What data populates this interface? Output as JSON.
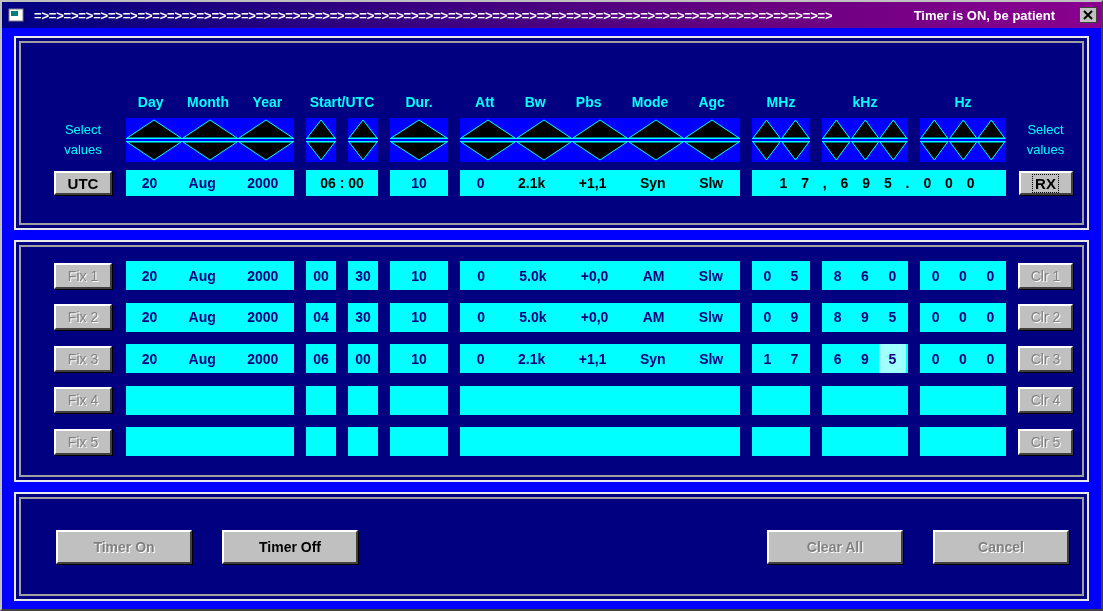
{
  "title_bar": {
    "marquee": "=>=>=>=>=>=>=>=>=>=>=>=>=>=>=>=>=>=>=>=>=>=>=>=>=>=>=>=>=>=>=>=>=>=>=>=>=>=>=>=>=>=>=>=>=>=>=>=>=>=>=>=>=>=>",
    "status": "Timer is ON, be patient"
  },
  "headers": {
    "date": [
      "Day",
      "Month",
      "Year"
    ],
    "start": "Start/UTC",
    "duration": "Dur.",
    "settings": [
      "Att",
      "Bw",
      "Pbs",
      "Mode",
      "Agc"
    ],
    "mhz": "MHz",
    "khz": "kHz",
    "hz": "Hz"
  },
  "select_left": "Select values",
  "select_right": "Select values",
  "current": {
    "utc_button": "UTC",
    "date": [
      "20",
      "Aug",
      "2000"
    ],
    "time": "06 : 00",
    "duration": "10",
    "settings": [
      "0",
      "2.1k",
      "+1,1",
      "Syn",
      "Slw"
    ],
    "frequency": "1 7 , 6 9 5 . 0 0 0",
    "rx_button": "RX"
  },
  "presets": [
    {
      "fix": "Fix 1",
      "clear": "Clr 1",
      "disabled": true,
      "date": [
        "20",
        "Aug",
        "2000"
      ],
      "hour": "00",
      "minute": "30",
      "duration": "10",
      "settings": [
        "0",
        "5.0k",
        "+0,0",
        "AM",
        "Slw"
      ],
      "mhz": [
        {
          "text": "0",
          "selected": false
        },
        {
          "text": "5",
          "selected": false
        }
      ],
      "khz": [
        {
          "text": "8",
          "selected": false
        },
        {
          "text": "6",
          "selected": false
        },
        {
          "text": "0",
          "selected": false
        }
      ],
      "hz": [
        {
          "text": "0",
          "selected": false
        },
        {
          "text": "0",
          "selected": false
        },
        {
          "text": "0",
          "selected": false
        }
      ]
    },
    {
      "fix": "Fix 2",
      "clear": "Clr 2",
      "disabled": true,
      "date": [
        "20",
        "Aug",
        "2000"
      ],
      "hour": "04",
      "minute": "30",
      "duration": "10",
      "settings": [
        "0",
        "5.0k",
        "+0,0",
        "AM",
        "Slw"
      ],
      "mhz": [
        {
          "text": "0",
          "selected": false
        },
        {
          "text": "9",
          "selected": false
        }
      ],
      "khz": [
        {
          "text": "8",
          "selected": false
        },
        {
          "text": "9",
          "selected": false
        },
        {
          "text": "5",
          "selected": false
        }
      ],
      "hz": [
        {
          "text": "0",
          "selected": false
        },
        {
          "text": "0",
          "selected": false
        },
        {
          "text": "0",
          "selected": false
        }
      ]
    },
    {
      "fix": "Fix 3",
      "clear": "Clr 3",
      "disabled": true,
      "date": [
        "20",
        "Aug",
        "2000"
      ],
      "hour": "06",
      "minute": "00",
      "duration": "10",
      "settings": [
        "0",
        "2.1k",
        "+1,1",
        "Syn",
        "Slw"
      ],
      "mhz": [
        {
          "text": "1",
          "selected": false
        },
        {
          "text": "7",
          "selected": false
        }
      ],
      "khz": [
        {
          "text": "6",
          "selected": false
        },
        {
          "text": "9",
          "selected": false
        },
        {
          "text": "5",
          "selected": true
        }
      ],
      "hz": [
        {
          "text": "0",
          "selected": false
        },
        {
          "text": "0",
          "selected": false
        },
        {
          "text": "0",
          "selected": false
        }
      ]
    },
    {
      "fix": "Fix 4",
      "clear": "Clr 4",
      "disabled": true
    },
    {
      "fix": "Fix 5",
      "clear": "Clr 5",
      "disabled": true
    }
  ],
  "bottom_buttons": [
    {
      "label": "Timer On",
      "disabled": true
    },
    {
      "label": "Timer Off",
      "disabled": false
    },
    {
      "label": "Clear All",
      "disabled": true
    },
    {
      "label": "Cancel",
      "disabled": true
    }
  ]
}
